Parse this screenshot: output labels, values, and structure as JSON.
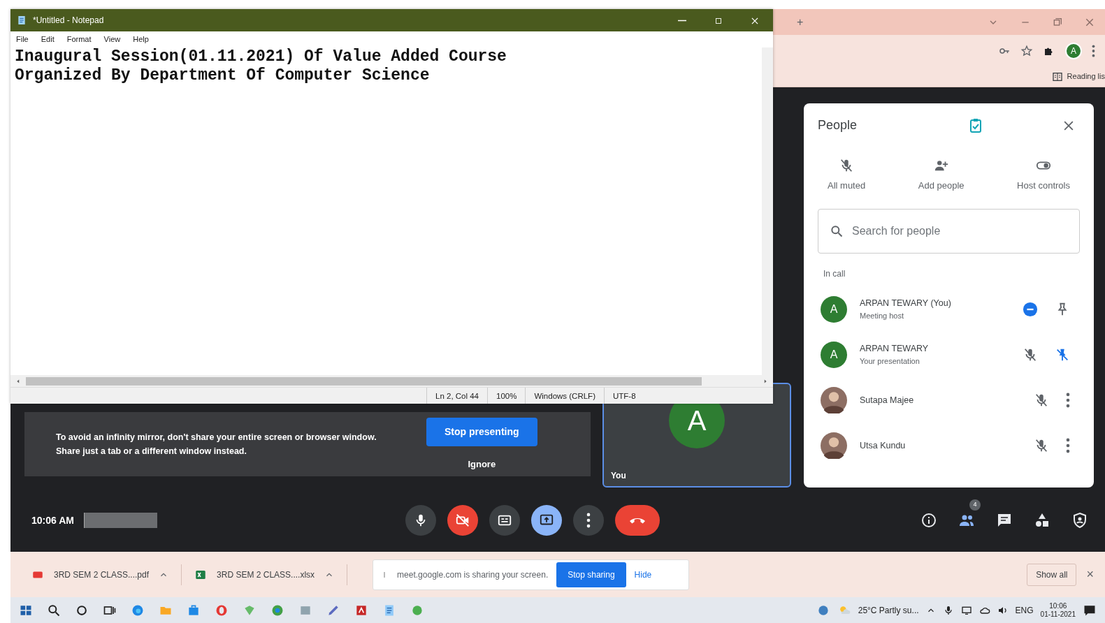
{
  "notepad": {
    "title": "*Untitled - Notepad",
    "menu": [
      "File",
      "Edit",
      "Format",
      "View",
      "Help"
    ],
    "lines": [
      "Inaugural Session(01.11.2021) Of Value Added Course",
      "Organized By Department Of Computer Science"
    ],
    "status": [
      "Ln 2, Col 44",
      "100%",
      "Windows (CRLF)",
      "UTF-8"
    ]
  },
  "browser": {
    "new_tab": "+",
    "profile_initial": "A",
    "reading_list": "Reading lis"
  },
  "presenting": {
    "warning": "To avoid an infinity mirror, don't share your entire screen or browser window. Share just a tab or a different window instead.",
    "stop_button": "Stop presenting",
    "ignore": "Ignore"
  },
  "self_tile": {
    "initial": "A",
    "label": "You"
  },
  "people_panel": {
    "title": "People",
    "actions": [
      {
        "kind": "mic-off",
        "label": "All muted"
      },
      {
        "kind": "person-add",
        "label": "Add people"
      },
      {
        "kind": "toggle",
        "label": "Host controls"
      }
    ],
    "search": {
      "placeholder": "Search for people"
    },
    "section": "In call",
    "participants": [
      {
        "kind": "initial",
        "initial": "A",
        "name": "ARPAN TEWARY (You)",
        "subtitle": "Meeting host",
        "controls": [
          {
            "kind": "speaking"
          },
          {
            "kind": "pin"
          }
        ]
      },
      {
        "kind": "initial",
        "initial": "A",
        "name": "ARPAN TEWARY",
        "subtitle": "Your presentation",
        "controls": [
          {
            "kind": "muted"
          },
          {
            "kind": "pinned"
          }
        ]
      },
      {
        "kind": "photo",
        "name": "Sutapa Majee",
        "controls": [
          {
            "kind": "muted"
          },
          {
            "kind": "more"
          }
        ]
      },
      {
        "kind": "photo",
        "name": "Utsa Kundu",
        "controls": [
          {
            "kind": "muted"
          },
          {
            "kind": "more"
          }
        ]
      }
    ]
  },
  "call_bar": {
    "time": "10:06 AM",
    "buttons": [
      {
        "kind": "mic",
        "selected": false
      },
      {
        "kind": "camera-off",
        "selected": false
      },
      {
        "kind": "captions",
        "selected": false
      },
      {
        "kind": "present",
        "selected": true
      },
      {
        "kind": "more",
        "selected": false
      },
      {
        "kind": "hangup",
        "selected": false
      }
    ],
    "side_buttons": [
      {
        "kind": "info",
        "selected": false
      },
      {
        "kind": "people",
        "selected": true,
        "badge": "4"
      },
      {
        "kind": "chat",
        "selected": false
      },
      {
        "kind": "activities",
        "selected": false
      },
      {
        "kind": "shield",
        "selected": false
      }
    ]
  },
  "downloads": [
    {
      "kind": "pdf",
      "name": "3RD SEM 2 CLASS....pdf"
    },
    {
      "kind": "xlsx",
      "name": "3RD SEM 2 CLASS....xlsx"
    }
  ],
  "share_banner": {
    "message": "meet.google.com is sharing your screen.",
    "stop": "Stop sharing",
    "hide": "Hide"
  },
  "download_bar": {
    "show_all": "Show all",
    "close": "×"
  },
  "taskbar": {
    "weather": "25°C Partly su...",
    "language": "ENG",
    "time": "10:06",
    "date": "01-11-2021"
  }
}
